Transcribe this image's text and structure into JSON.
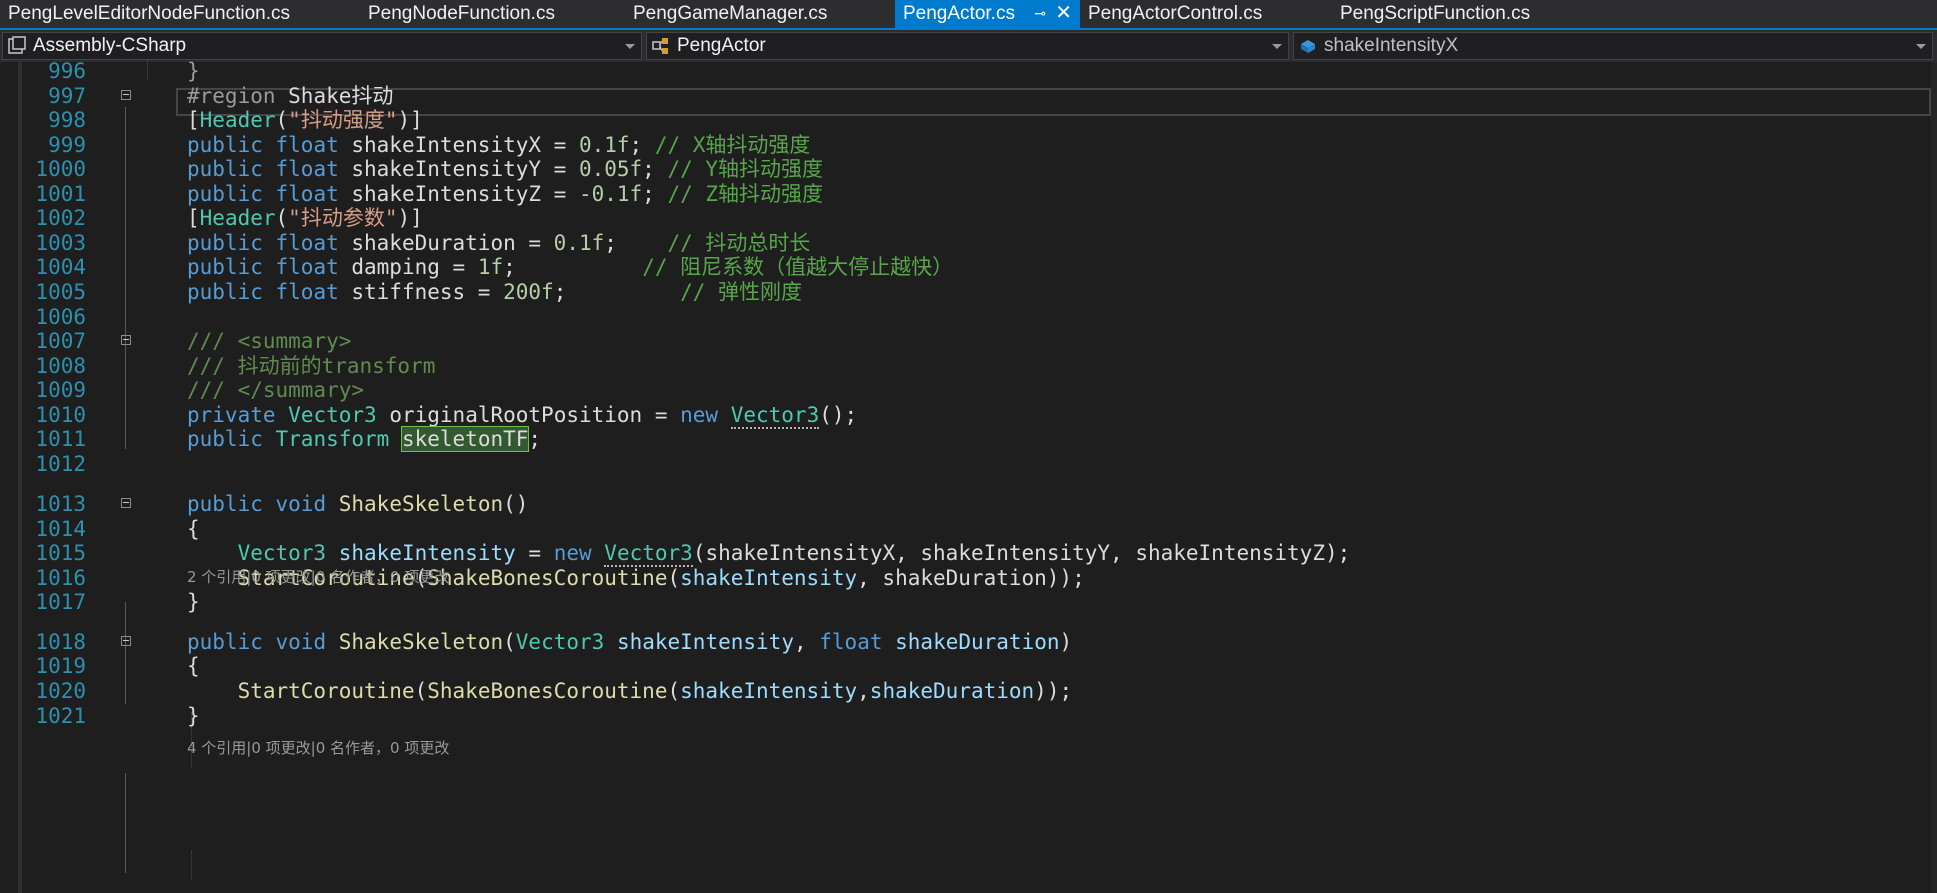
{
  "tabs": [
    {
      "label": "PengLevelEditorNodeFunction.cs",
      "active": false
    },
    {
      "label": "PengNodeFunction.cs",
      "active": false
    },
    {
      "label": "PengGameManager.cs",
      "active": false
    },
    {
      "label": "PengActor.cs",
      "active": true
    },
    {
      "label": "PengActorControl.cs",
      "active": false
    },
    {
      "label": "PengScriptFunction.cs",
      "active": false
    }
  ],
  "nav": {
    "project": "Assembly-CSharp",
    "type": "PengActor",
    "member": "shakeIntensityX"
  },
  "code_lens": [
    "2 个引用|0 项更改|0 名作者，0 项更改",
    "4 个引用|0 项更改|0 名作者，0 项更改"
  ],
  "lines": [
    {
      "num": "996",
      "tokens": [
        [
          "p",
          "}"
        ]
      ]
    },
    {
      "num": "997",
      "tokens": [
        [
          "p",
          "#region "
        ],
        [
          "",
          "Shake抖动"
        ]
      ]
    },
    {
      "num": "998",
      "tokens": [
        [
          "",
          "["
        ],
        [
          "t",
          "Header"
        ],
        [
          "",
          "("
        ],
        [
          "s",
          "\"抖动强度\""
        ],
        [
          "",
          ")]"
        ]
      ]
    },
    {
      "num": "999",
      "tokens": [
        [
          "k",
          "public"
        ],
        [
          "",
          " "
        ],
        [
          "k",
          "float"
        ],
        [
          "",
          " shakeIntensityX = "
        ],
        [
          "n",
          "0.1f"
        ],
        [
          "",
          "; "
        ],
        [
          "c",
          "// X轴抖动强度"
        ]
      ]
    },
    {
      "num": "1000",
      "tokens": [
        [
          "k",
          "public"
        ],
        [
          "",
          " "
        ],
        [
          "k",
          "float"
        ],
        [
          "",
          " shakeIntensityY = "
        ],
        [
          "n",
          "0.05f"
        ],
        [
          "",
          "; "
        ],
        [
          "c",
          "// Y轴抖动强度"
        ]
      ]
    },
    {
      "num": "1001",
      "tokens": [
        [
          "k",
          "public"
        ],
        [
          "",
          " "
        ],
        [
          "k",
          "float"
        ],
        [
          "",
          " shakeIntensityZ = "
        ],
        [
          "n",
          "-0.1f"
        ],
        [
          "",
          "; "
        ],
        [
          "c",
          "// Z轴抖动强度"
        ]
      ]
    },
    {
      "num": "1002",
      "tokens": [
        [
          "",
          "["
        ],
        [
          "t",
          "Header"
        ],
        [
          "",
          "("
        ],
        [
          "s",
          "\"抖动参数\""
        ],
        [
          "",
          ")]"
        ]
      ]
    },
    {
      "num": "1003",
      "tokens": [
        [
          "k",
          "public"
        ],
        [
          "",
          " "
        ],
        [
          "k",
          "float"
        ],
        [
          "",
          " shakeDuration = "
        ],
        [
          "n",
          "0.1f"
        ],
        [
          "",
          ";    "
        ],
        [
          "c",
          "// 抖动总时长"
        ]
      ]
    },
    {
      "num": "1004",
      "tokens": [
        [
          "k",
          "public"
        ],
        [
          "",
          " "
        ],
        [
          "k",
          "float"
        ],
        [
          "",
          " damping = "
        ],
        [
          "n",
          "1f"
        ],
        [
          "",
          ";          "
        ],
        [
          "c",
          "// 阻尼系数（值越大停止越快）"
        ]
      ]
    },
    {
      "num": "1005",
      "tokens": [
        [
          "k",
          "public"
        ],
        [
          "",
          " "
        ],
        [
          "k",
          "float"
        ],
        [
          "",
          " stiffness = "
        ],
        [
          "n",
          "200f"
        ],
        [
          "",
          ";         "
        ],
        [
          "c",
          "// 弹性刚度"
        ]
      ]
    },
    {
      "num": "1006",
      "tokens": []
    },
    {
      "num": "1007",
      "tokens": [
        [
          "cx",
          "/// <summary>"
        ]
      ]
    },
    {
      "num": "1008",
      "tokens": [
        [
          "cx",
          "/// 抖动前的transform"
        ]
      ]
    },
    {
      "num": "1009",
      "tokens": [
        [
          "cx",
          "/// </summary>"
        ]
      ]
    },
    {
      "num": "1010",
      "tokens": [
        [
          "k",
          "private"
        ],
        [
          "",
          " "
        ],
        [
          "t",
          "Vector3"
        ],
        [
          "",
          " originalRootPosition = "
        ],
        [
          "k",
          "new"
        ],
        [
          "",
          " "
        ],
        [
          "tq",
          "Vector3"
        ],
        [
          "",
          "();"
        ]
      ]
    },
    {
      "num": "1011",
      "tokens": [
        [
          "k",
          "public"
        ],
        [
          "",
          " "
        ],
        [
          "t",
          "Transform"
        ],
        [
          "",
          " "
        ],
        [
          "hl",
          "skeletonTF"
        ],
        [
          "",
          ";"
        ]
      ]
    },
    {
      "num": "1012",
      "tokens": []
    },
    {
      "num": "1013",
      "tokens": [
        [
          "k",
          "public"
        ],
        [
          "",
          " "
        ],
        [
          "k",
          "void"
        ],
        [
          "",
          " "
        ],
        [
          "m",
          "ShakeSkeleton"
        ],
        [
          "",
          "()"
        ]
      ]
    },
    {
      "num": "1014",
      "tokens": [
        [
          "",
          "{"
        ]
      ]
    },
    {
      "num": "1015",
      "tokens": [
        [
          "",
          "    "
        ],
        [
          "t",
          "Vector3"
        ],
        [
          "",
          " "
        ],
        [
          "v",
          "shakeIntensity"
        ],
        [
          "",
          " = "
        ],
        [
          "k",
          "new"
        ],
        [
          "",
          " "
        ],
        [
          "tq",
          "Vector3"
        ],
        [
          "",
          "(shakeIntensityX, shakeIntensityY, shakeIntensityZ);"
        ]
      ]
    },
    {
      "num": "1016",
      "tokens": [
        [
          "",
          "    "
        ],
        [
          "m",
          "StartCoroutine"
        ],
        [
          "",
          "("
        ],
        [
          "m",
          "ShakeBonesCoroutine"
        ],
        [
          "",
          "("
        ],
        [
          "v",
          "shakeIntensity"
        ],
        [
          "",
          ", shakeDuration));"
        ]
      ]
    },
    {
      "num": "1017",
      "tokens": [
        [
          "",
          "}"
        ]
      ]
    },
    {
      "num": "1018",
      "tokens": [
        [
          "k",
          "public"
        ],
        [
          "",
          " "
        ],
        [
          "k",
          "void"
        ],
        [
          "",
          " "
        ],
        [
          "m",
          "ShakeSkeleton"
        ],
        [
          "",
          "("
        ],
        [
          "t",
          "Vector3"
        ],
        [
          "",
          " "
        ],
        [
          "v",
          "shakeIntensity"
        ],
        [
          "",
          ", "
        ],
        [
          "k",
          "float"
        ],
        [
          "",
          " "
        ],
        [
          "v",
          "shakeDuration"
        ],
        [
          "",
          ")"
        ]
      ]
    },
    {
      "num": "1019",
      "tokens": [
        [
          "",
          "{"
        ]
      ]
    },
    {
      "num": "1020",
      "tokens": [
        [
          "",
          "    "
        ],
        [
          "m",
          "StartCoroutine"
        ],
        [
          "",
          "("
        ],
        [
          "m",
          "ShakeBonesCoroutine"
        ],
        [
          "",
          "("
        ],
        [
          "v",
          "shakeIntensity"
        ],
        [
          "",
          ","
        ],
        [
          "v",
          "shakeDuration"
        ],
        [
          "",
          "));"
        ]
      ]
    },
    {
      "num": "1021",
      "tokens": [
        [
          "",
          "}"
        ]
      ]
    }
  ]
}
